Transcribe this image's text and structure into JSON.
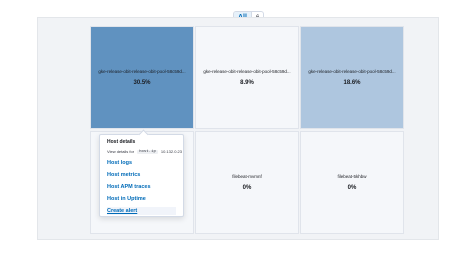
{
  "filter": {
    "all_label": "All",
    "count": "6"
  },
  "tiles": [
    {
      "name": "gke-release-obit-release-obit-pool-58c59d...",
      "value": "30.5%"
    },
    {
      "name": "gke-release-obit-release-obit-pool-58c59d...",
      "value": "8.9%"
    },
    {
      "name": "gke-release-obit-release-obit-pool-58c59d...",
      "value": "18.6%"
    },
    {
      "name": "",
      "value": ""
    },
    {
      "name": "filebeat-mvmnf",
      "value": "0%"
    },
    {
      "name": "filebeat-5khbw",
      "value": "0%"
    }
  ],
  "popover": {
    "title": "Host details",
    "view_details_prefix": "View details for",
    "field": "host.ip",
    "ip": "10.132.0.23",
    "links": [
      "Host logs",
      "Host metrics",
      "Host APM traces",
      "Host in Uptime"
    ],
    "create_alert": "Create alert"
  },
  "colors": {
    "tile_high": "#6092c0",
    "tile_mid": "#aec6df",
    "tile_low": "#f5f7fa",
    "link": "#006bb8"
  }
}
